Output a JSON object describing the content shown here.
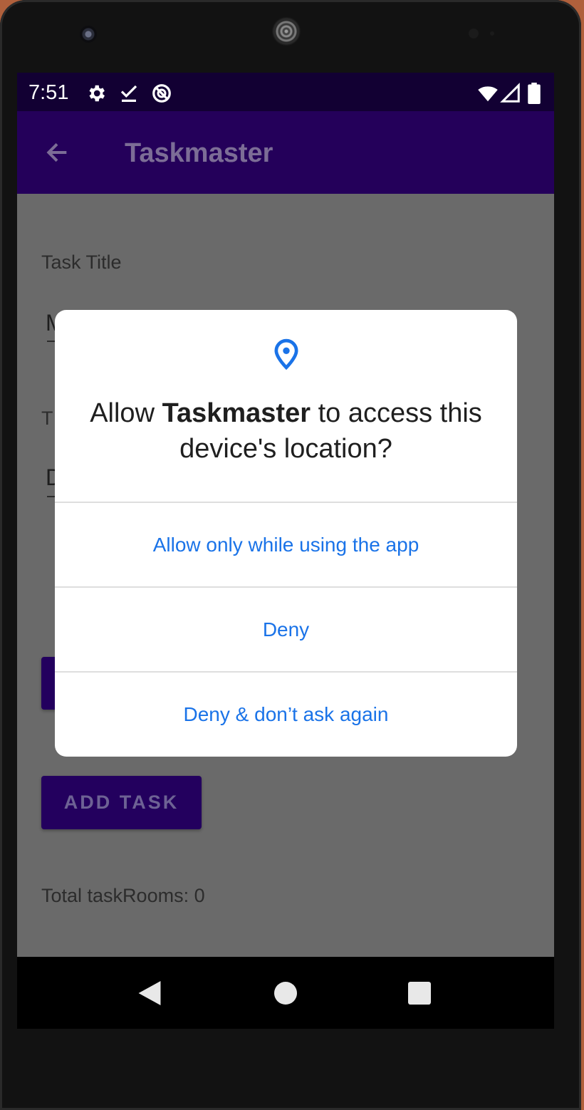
{
  "status_bar": {
    "time": "7:51",
    "left_icons": [
      "settings-icon",
      "download-done-icon",
      "no-disturb-icon"
    ],
    "right_icons": [
      "wifi-icon",
      "cell-signal-icon",
      "battery-icon"
    ]
  },
  "app_bar": {
    "title": "Taskmaster",
    "back_icon": "arrow-back-icon",
    "color": "#24005a"
  },
  "form": {
    "task_title_label": "Task Title",
    "task_title_value_visible": "M",
    "task_desc_label_visible": "T",
    "task_desc_value_visible": "D",
    "add_task_button": "ADD TASK",
    "total_text": "Total taskRooms: 0"
  },
  "dialog": {
    "icon": "location-pin-icon",
    "title_prefix": "Allow ",
    "title_app": "Taskmaster",
    "title_suffix": " to access this device's location?",
    "options": [
      "Allow only while using the app",
      "Deny",
      "Deny & don’t ask again"
    ],
    "accent": "#1a73e8"
  },
  "nav_bar": {
    "icons": [
      "back-triangle-icon",
      "home-circle-icon",
      "recents-square-icon"
    ]
  }
}
